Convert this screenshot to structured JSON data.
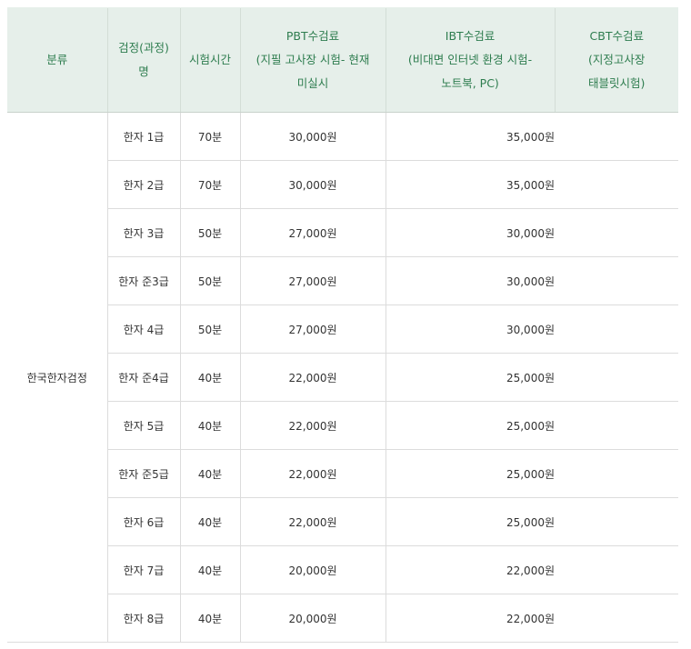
{
  "header": {
    "category": "분류",
    "course_line1": "검정(과정)",
    "course_line2": "명",
    "duration": "시험시간",
    "pbt_line1": "PBT수검료",
    "pbt_line2": "(지필 고사장 시험- 현재",
    "pbt_line3": "미실시",
    "ibt_line1": "IBT수검료",
    "ibt_line2": "(비대면 인터넷 환경 시험-",
    "ibt_line3": "노트북, PC)",
    "cbt_line1": "CBT수검료",
    "cbt_line2": "(지정고사장",
    "cbt_line3": "태블릿시험)"
  },
  "category": "한국한자검정",
  "rows": [
    {
      "course": "한자 1급",
      "duration": "70분",
      "pbt": "30,000원",
      "ibt": "35,000원"
    },
    {
      "course": "한자 2급",
      "duration": "70분",
      "pbt": "30,000원",
      "ibt": "35,000원"
    },
    {
      "course": "한자 3급",
      "duration": "50분",
      "pbt": "27,000원",
      "ibt": "30,000원"
    },
    {
      "course": "한자 준3급",
      "duration": "50분",
      "pbt": "27,000원",
      "ibt": "30,000원"
    },
    {
      "course": "한자 4급",
      "duration": "50분",
      "pbt": "27,000원",
      "ibt": "30,000원"
    },
    {
      "course": "한자 준4급",
      "duration": "40분",
      "pbt": "22,000원",
      "ibt": "25,000원"
    },
    {
      "course": "한자 5급",
      "duration": "40분",
      "pbt": "22,000원",
      "ibt": "25,000원"
    },
    {
      "course": "한자 준5급",
      "duration": "40분",
      "pbt": "22,000원",
      "ibt": "25,000원"
    },
    {
      "course": "한자 6급",
      "duration": "40분",
      "pbt": "22,000원",
      "ibt": "25,000원"
    },
    {
      "course": "한자 7급",
      "duration": "40분",
      "pbt": "20,000원",
      "ibt": "22,000원"
    },
    {
      "course": "한자 8급",
      "duration": "40분",
      "pbt": "20,000원",
      "ibt": "22,000원"
    }
  ],
  "colors": {
    "header_bg": "#e6efea",
    "header_text": "#2e7d4f",
    "border": "#dcdcdc"
  }
}
